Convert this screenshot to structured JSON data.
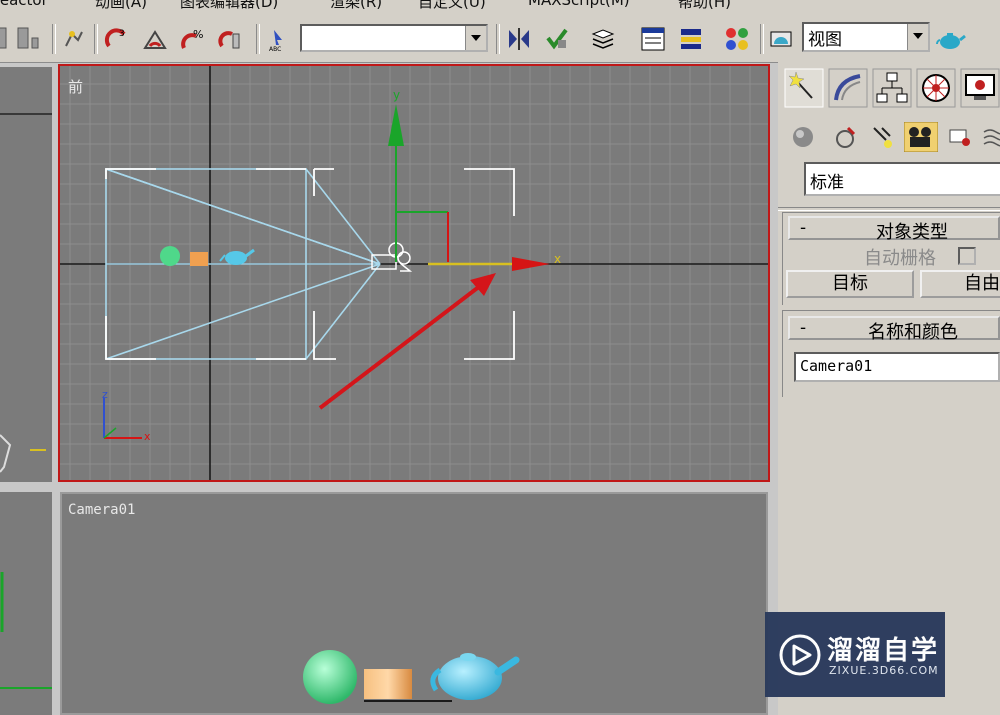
{
  "menu": {
    "items": [
      "reactor",
      "动画(A)",
      "图表编辑器(D)",
      "渲染(R)",
      "自定义(U)",
      "MAXScript(M)",
      "帮助(H)"
    ]
  },
  "toolbar": {
    "selection_set_value": "",
    "view_dropdown_value": "视图"
  },
  "viewports": {
    "front_label": "前",
    "camera_label": "Camera01",
    "axis_y": "y",
    "axis_x": "x",
    "mini_axis_z": "z",
    "mini_axis_x": "x"
  },
  "command_panel": {
    "tabs": [
      "create-tab",
      "modify-tab",
      "hierarchy-tab",
      "motion-tab",
      "display-tab"
    ],
    "category_icons": [
      "geometry-icon",
      "shapes-icon",
      "lights-icon",
      "cameras-icon",
      "helpers-icon",
      "spacewarps-icon"
    ],
    "subcategory_value": "标准",
    "object_type_title": "对象类型",
    "auto_grid_label": "自动栅格",
    "auto_grid_checked": false,
    "target_button": "目标",
    "free_button": "自由",
    "name_color_title": "名称和颜色",
    "name_value": "Camera01",
    "rollout_minus": "-"
  },
  "watermark": {
    "title": "溜溜自学",
    "url": "ZIXUE.3D66.COM"
  },
  "colors": {
    "viewport_bg": "#7b7b7b",
    "active_border": "#c01818",
    "camera_cyan": "#a8d8ec",
    "axis_green": "#1aa52a",
    "axis_red": "#d61414",
    "axis_yellow": "#d8c020",
    "annotation_arrow": "#d4151a",
    "sphere": "#4fd88a",
    "box": "#f0a050",
    "teapot": "#56c8e8"
  }
}
